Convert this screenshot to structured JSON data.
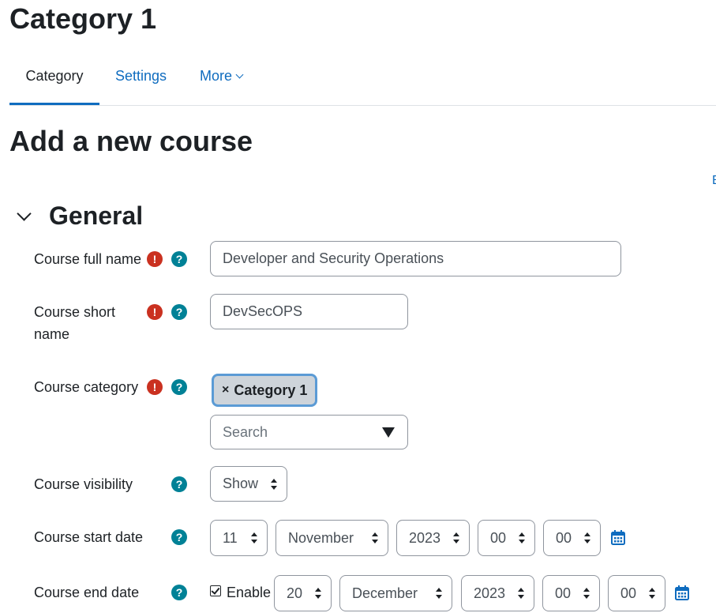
{
  "page": {
    "title": "Category 1"
  },
  "tabs": [
    {
      "label": "Category",
      "active": true
    },
    {
      "label": "Settings",
      "active": false
    },
    {
      "label": "More",
      "active": false
    }
  ],
  "heading": "Add a new course",
  "expand_all_fragment": "E",
  "section": {
    "title": "General"
  },
  "fields": {
    "full_name": {
      "label": "Course full name",
      "value": "Developer and Security Operations"
    },
    "short_name": {
      "label_line1": "Course short",
      "label_line2": "name",
      "value": "DevSecOPS"
    },
    "category": {
      "label": "Course category",
      "selected": "Category 1",
      "remove_glyph": "×",
      "search_placeholder": "Search"
    },
    "visibility": {
      "label": "Course visibility",
      "value": "Show"
    },
    "start_date": {
      "label": "Course start date",
      "day": "11",
      "month": "November",
      "year": "2023",
      "hour": "00",
      "minute": "00"
    },
    "end_date": {
      "label": "Course end date",
      "enable_label": "Enable",
      "enabled": true,
      "day": "20",
      "month": "December",
      "year": "2023",
      "hour": "00",
      "minute": "00"
    }
  },
  "icons": {
    "required": "!",
    "help": "?"
  },
  "colors": {
    "link": "#0f6cbf",
    "required": "#ca3120",
    "help": "#008196",
    "tag_border": "#5b9bd5"
  }
}
